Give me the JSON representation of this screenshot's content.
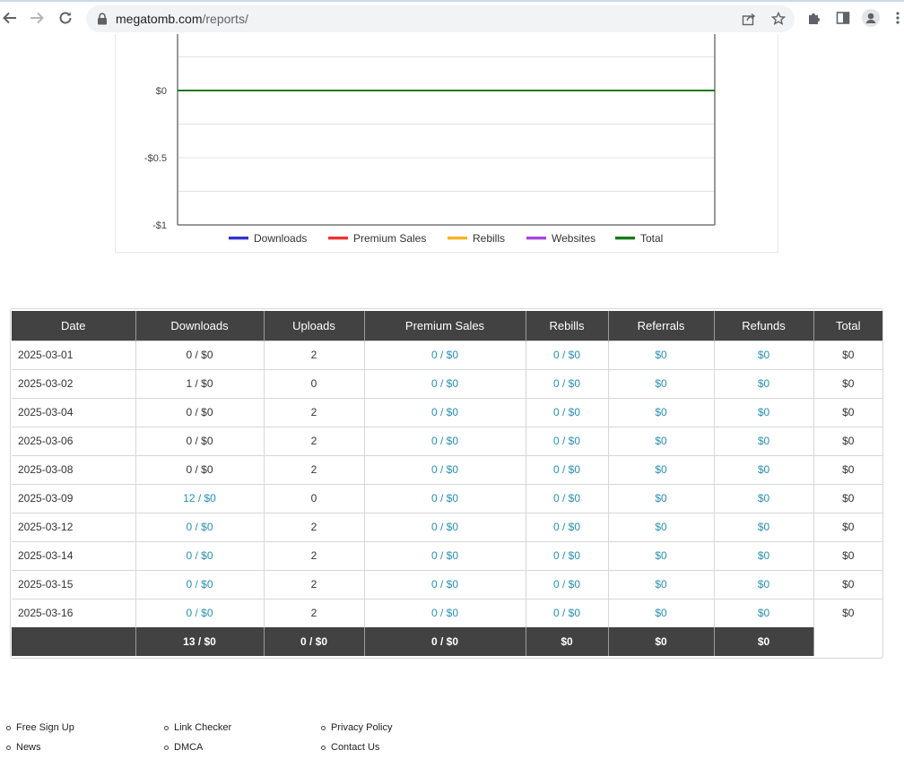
{
  "browser": {
    "url_host": "megatomb.com",
    "url_path": "/reports/"
  },
  "chart_data": {
    "type": "line",
    "x": [
      "2025-03-01",
      "2025-03-02",
      "2025-03-04",
      "2025-03-06",
      "2025-03-08",
      "2025-03-09",
      "2025-03-12",
      "2025-03-14",
      "2025-03-15",
      "2025-03-16"
    ],
    "series": [
      {
        "name": "Downloads",
        "color": "#3333cc",
        "values": [
          0,
          0,
          0,
          0,
          0,
          0,
          0,
          0,
          0,
          0
        ]
      },
      {
        "name": "Premium Sales",
        "color": "#ee3333",
        "values": [
          0,
          0,
          0,
          0,
          0,
          0,
          0,
          0,
          0,
          0
        ]
      },
      {
        "name": "Rebills",
        "color": "#f5b324",
        "values": [
          0,
          0,
          0,
          0,
          0,
          0,
          0,
          0,
          0,
          0
        ]
      },
      {
        "name": "Websites",
        "color": "#aa44dd",
        "values": [
          0,
          0,
          0,
          0,
          0,
          0,
          0,
          0,
          0,
          0
        ]
      },
      {
        "name": "Total",
        "color": "#1a7a1a",
        "values": [
          0,
          0,
          0,
          0,
          0,
          0,
          0,
          0,
          0,
          0
        ]
      }
    ],
    "ylim": [
      -1,
      0.5
    ],
    "y_ticks": [
      {
        "value": 0,
        "label": "$0"
      },
      {
        "value": -0.5,
        "label": "-$0.5"
      },
      {
        "value": -1,
        "label": "-$1"
      }
    ],
    "grid": true,
    "legend_position": "bottom"
  },
  "table": {
    "headers": [
      "Date",
      "Downloads",
      "Uploads",
      "Premium Sales",
      "Rebills",
      "Referrals",
      "Refunds",
      "Total"
    ],
    "rows": [
      {
        "date": "2025-03-01",
        "downloads": "0 / $0",
        "downloads_link": false,
        "uploads": "2",
        "premium": "0 / $0",
        "rebills": "0 / $0",
        "referrals": "$0",
        "refunds": "$0",
        "total": "$0"
      },
      {
        "date": "2025-03-02",
        "downloads": "1 / $0",
        "downloads_link": false,
        "uploads": "0",
        "premium": "0 / $0",
        "rebills": "0 / $0",
        "referrals": "$0",
        "refunds": "$0",
        "total": "$0"
      },
      {
        "date": "2025-03-04",
        "downloads": "0 / $0",
        "downloads_link": false,
        "uploads": "2",
        "premium": "0 / $0",
        "rebills": "0 / $0",
        "referrals": "$0",
        "refunds": "$0",
        "total": "$0"
      },
      {
        "date": "2025-03-06",
        "downloads": "0 / $0",
        "downloads_link": false,
        "uploads": "2",
        "premium": "0 / $0",
        "rebills": "0 / $0",
        "referrals": "$0",
        "refunds": "$0",
        "total": "$0"
      },
      {
        "date": "2025-03-08",
        "downloads": "0 / $0",
        "downloads_link": false,
        "uploads": "2",
        "premium": "0 / $0",
        "rebills": "0 / $0",
        "referrals": "$0",
        "refunds": "$0",
        "total": "$0"
      },
      {
        "date": "2025-03-09",
        "downloads": "12 / $0",
        "downloads_link": true,
        "uploads": "0",
        "premium": "0 / $0",
        "rebills": "0 / $0",
        "referrals": "$0",
        "refunds": "$0",
        "total": "$0"
      },
      {
        "date": "2025-03-12",
        "downloads": "0 / $0",
        "downloads_link": true,
        "uploads": "2",
        "premium": "0 / $0",
        "rebills": "0 / $0",
        "referrals": "$0",
        "refunds": "$0",
        "total": "$0"
      },
      {
        "date": "2025-03-14",
        "downloads": "0 / $0",
        "downloads_link": true,
        "uploads": "2",
        "premium": "0 / $0",
        "rebills": "0 / $0",
        "referrals": "$0",
        "refunds": "$0",
        "total": "$0"
      },
      {
        "date": "2025-03-15",
        "downloads": "0 / $0",
        "downloads_link": true,
        "uploads": "2",
        "premium": "0 / $0",
        "rebills": "0 / $0",
        "referrals": "$0",
        "refunds": "$0",
        "total": "$0"
      },
      {
        "date": "2025-03-16",
        "downloads": "0 / $0",
        "downloads_link": true,
        "uploads": "2",
        "premium": "0 / $0",
        "rebills": "0 / $0",
        "referrals": "$0",
        "refunds": "$0",
        "total": "$0"
      }
    ],
    "totals": [
      "",
      "13 / $0",
      "0 / $0",
      "0 / $0",
      "$0",
      "$0",
      "$0",
      ""
    ]
  },
  "footer": {
    "col1": [
      "Free Sign Up",
      "News"
    ],
    "col2": [
      "Link Checker",
      "DMCA"
    ],
    "col3": [
      "Privacy Policy",
      "Contact Us"
    ]
  }
}
